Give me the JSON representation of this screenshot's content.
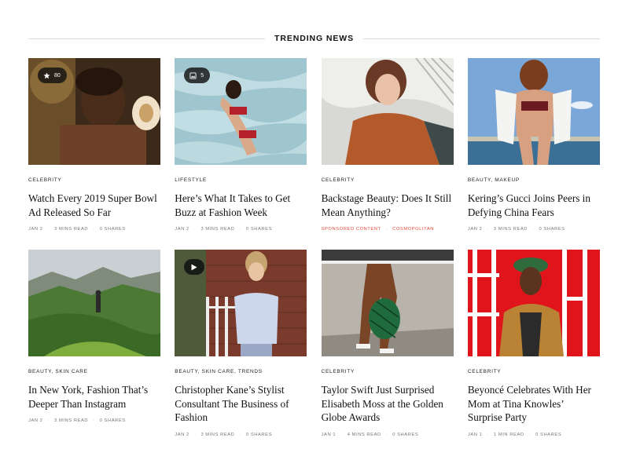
{
  "section": {
    "title": "TRENDING NEWS"
  },
  "articles": [
    {
      "category": "CELEBRITY",
      "headline": "Watch Every 2019 Super Bowl Ad Released So Far",
      "date": "JAN 2",
      "read_time": "3 MINS READ",
      "shares": "0 SHARES",
      "badge": {
        "icon": "star-icon",
        "count": "80"
      }
    },
    {
      "category": "LIFESTYLE",
      "headline": "Here’s What It Takes to Get Buzz at Fashion Week",
      "date": "JAN 2",
      "read_time": "3 MINS READ",
      "shares": "0 SHARES",
      "badge": {
        "icon": "gallery-icon",
        "count": "5"
      }
    },
    {
      "category": "CELEBRITY",
      "headline": "Backstage Beauty: Does It Still Mean Anything?",
      "sponsored_label": "SPONSORED CONTENT",
      "sponsor": "COSMOPOLITAN",
      "sponsor_color": "#e4483a"
    },
    {
      "category": "BEAUTY, MAKEUP",
      "headline": "Kering’s Gucci Joins Peers in Defying China Fears",
      "date": "JAN 2",
      "read_time": "3 MINS READ",
      "shares": "0 SHARES"
    },
    {
      "category": "BEAUTY, SKIN CARE",
      "headline": "In New York, Fashion That’s Deeper Than Instagram",
      "date": "JAN 2",
      "read_time": "3 MINS READ",
      "shares": "0 SHARES"
    },
    {
      "category": "BEAUTY, SKIN CARE, TRENDS",
      "headline": "Christopher Kane’s Stylist Consultant The Business of Fashion",
      "date": "JAN 2",
      "read_time": "3 MINS READ",
      "shares": "0 SHARES",
      "badge": {
        "icon": "play-icon"
      }
    },
    {
      "category": "CELEBRITY",
      "headline": "Taylor Swift Just Surprised Elisabeth Moss at the Golden Globe Awards",
      "date": "JAN 1",
      "read_time": "4 MINS READ",
      "shares": "0 SHARES"
    },
    {
      "category": "CELEBRITY",
      "headline": "Beyoncé Celebrates With Her Mom at Tina Knowles’ Surprise Party",
      "date": "JAN 1",
      "read_time": "1 MIN READ",
      "shares": "0 SHARES"
    }
  ]
}
